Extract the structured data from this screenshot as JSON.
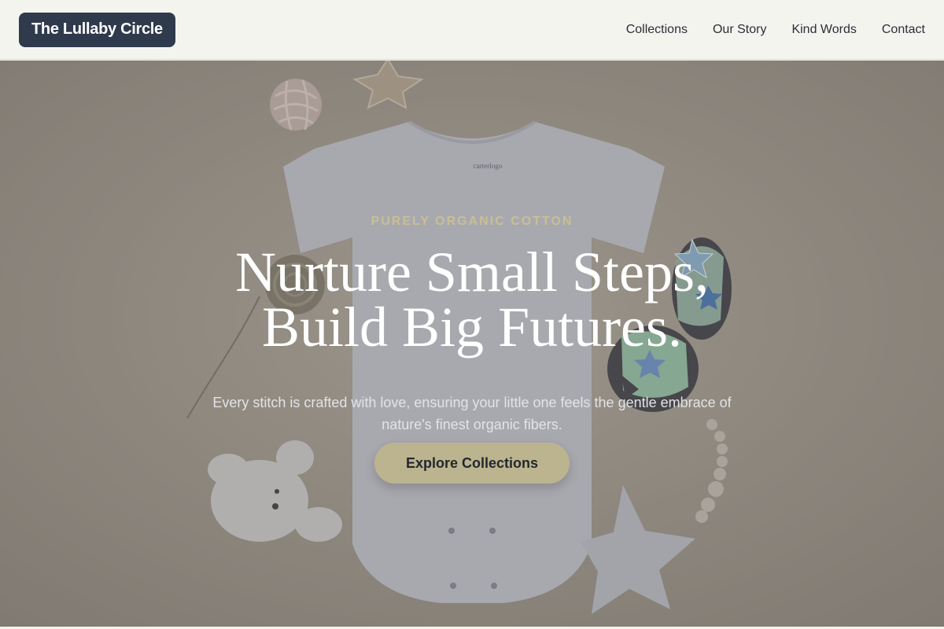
{
  "header": {
    "brand": "The Lullaby Circle",
    "nav": [
      "Collections",
      "Our Story",
      "Kind Words",
      "Contact"
    ]
  },
  "hero": {
    "eyebrow": "PURELY ORGANIC COTTON",
    "headline_line1": "Nurture Small Steps,",
    "headline_line2": "Build Big Futures.",
    "subtext": "Every stitch is crafted with love, ensuring your little one feels the gentle embrace of nature's finest organic fibers.",
    "cta": "Explore Collections",
    "onesie_tag": "carterlogo"
  },
  "colors": {
    "brand_bg": "#2f3a4d",
    "eyebrow": "#c9bf94",
    "cta_bg": "#bcb48e",
    "header_bg": "#f4f4ef"
  }
}
